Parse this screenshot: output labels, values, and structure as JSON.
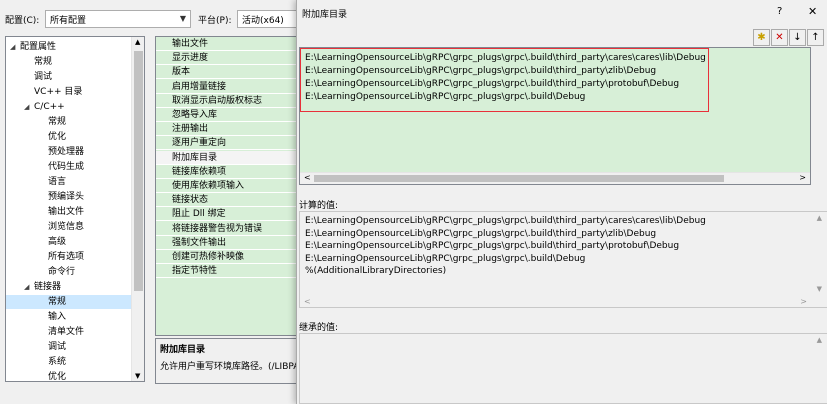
{
  "header": {
    "config_label": "配置(C):",
    "config_value": "所有配置",
    "platform_label": "平台(P):",
    "platform_value": "活动(x64)"
  },
  "tree": [
    {
      "label": "配置属性",
      "level": 0,
      "expanded": true
    },
    {
      "label": "常规",
      "level": 1
    },
    {
      "label": "调试",
      "level": 1
    },
    {
      "label": "VC++ 目录",
      "level": 1
    },
    {
      "label": "C/C++",
      "level": 1,
      "expanded": true
    },
    {
      "label": "常规",
      "level": 2
    },
    {
      "label": "优化",
      "level": 2
    },
    {
      "label": "预处理器",
      "level": 2
    },
    {
      "label": "代码生成",
      "level": 2
    },
    {
      "label": "语言",
      "level": 2
    },
    {
      "label": "预编译头",
      "level": 2
    },
    {
      "label": "输出文件",
      "level": 2
    },
    {
      "label": "浏览信息",
      "level": 2
    },
    {
      "label": "高级",
      "level": 2
    },
    {
      "label": "所有选项",
      "level": 2
    },
    {
      "label": "命令行",
      "level": 2
    },
    {
      "label": "链接器",
      "level": 1,
      "expanded": true
    },
    {
      "label": "常规",
      "level": 2,
      "selected": true
    },
    {
      "label": "输入",
      "level": 2
    },
    {
      "label": "清单文件",
      "level": 2
    },
    {
      "label": "调试",
      "level": 2
    },
    {
      "label": "系统",
      "level": 2
    },
    {
      "label": "优化",
      "level": 2
    }
  ],
  "properties": [
    {
      "name": "输出文件"
    },
    {
      "name": "显示进度"
    },
    {
      "name": "版本"
    },
    {
      "name": "启用增量链接"
    },
    {
      "name": "取消显示启动版权标志"
    },
    {
      "name": "忽略导入库"
    },
    {
      "name": "注册输出"
    },
    {
      "name": "逐用户重定向"
    },
    {
      "name": "附加库目录",
      "selected": true
    },
    {
      "name": "链接库依赖项"
    },
    {
      "name": "使用库依赖项输入"
    },
    {
      "name": "链接状态"
    },
    {
      "name": "阻止 Dll 绑定"
    },
    {
      "name": "将链接器警告视为错误"
    },
    {
      "name": "强制文件输出"
    },
    {
      "name": "创建可热修补映像"
    },
    {
      "name": "指定节特性"
    }
  ],
  "description": {
    "title": "附加库目录",
    "text": "允许用户重写环境库路径。(/LIBPA"
  },
  "dialog": {
    "title": "附加库目录",
    "help": "?",
    "close": "✕",
    "entries": [
      "E:\\LearningOpensourceLib\\gRPC\\grpc_plugs\\grpc\\.build\\third_party\\cares\\cares\\lib\\Debug",
      "E:\\LearningOpensourceLib\\gRPC\\grpc_plugs\\grpc\\.build\\third_party\\zlib\\Debug",
      "E:\\LearningOpensourceLib\\gRPC\\grpc_plugs\\grpc\\.build\\third_party\\protobuf\\Debug",
      "E:\\LearningOpensourceLib\\gRPC\\grpc_plugs\\grpc\\.build\\Debug"
    ],
    "evaluated_label": "计算的值:",
    "evaluated": [
      "E:\\LearningOpensourceLib\\gRPC\\grpc_plugs\\grpc\\.build\\third_party\\cares\\cares\\lib\\Debug",
      "E:\\LearningOpensourceLib\\gRPC\\grpc_plugs\\grpc\\.build\\third_party\\zlib\\Debug",
      "E:\\LearningOpensourceLib\\gRPC\\grpc_plugs\\grpc\\.build\\third_party\\protobuf\\Debug",
      "E:\\LearningOpensourceLib\\gRPC\\grpc_plugs\\grpc\\.build\\Debug",
      "%(AdditionalLibraryDirectories)"
    ],
    "inherited_label": "继承的值:"
  },
  "colors": {
    "green": "#d7efd7",
    "highlight": "#e8303a",
    "selected": "#cce8ff"
  }
}
